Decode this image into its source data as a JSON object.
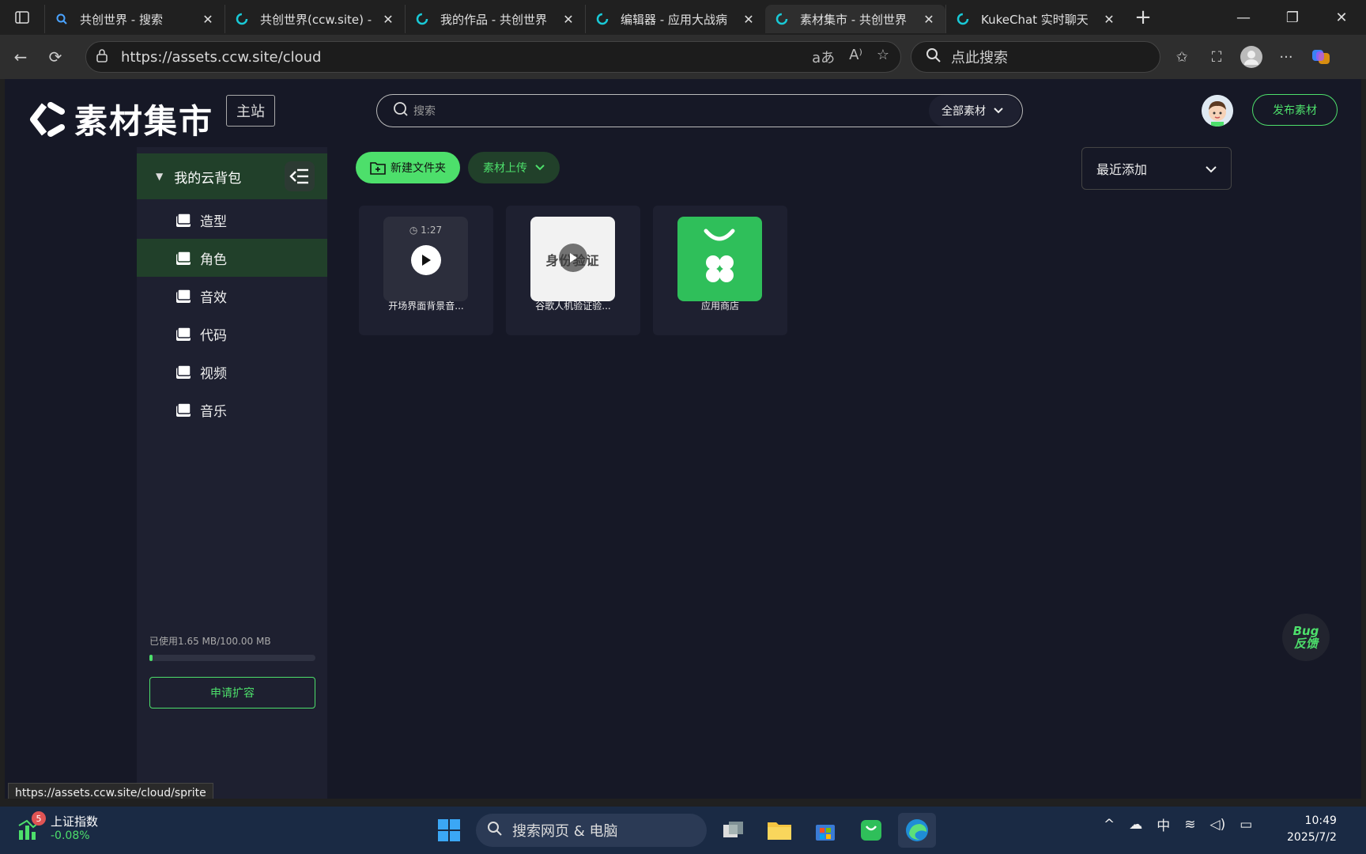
{
  "browser": {
    "tabs": [
      {
        "title": "共创世界 - 搜索",
        "icon": "search-icon",
        "active": false
      },
      {
        "title": "共创世界(ccw.site) -",
        "icon": "ccw-icon",
        "active": false
      },
      {
        "title": "我的作品 - 共创世界",
        "icon": "ccw-icon",
        "active": false
      },
      {
        "title": "编辑器 - 应用大战病",
        "icon": "ccw-icon",
        "active": false
      },
      {
        "title": "素材集市 - 共创世界",
        "icon": "ccw-icon",
        "active": true
      },
      {
        "title": "KukeChat 实时聊天",
        "icon": "ccw-icon",
        "active": false
      }
    ],
    "url": "https://assets.ccw.site/cloud",
    "search_placeholder": "点此搜索",
    "status_url": "https://assets.ccw.site/cloud/sprite"
  },
  "site": {
    "logo_text": "素材集市",
    "main_site_label": "主站",
    "search_placeholder": "搜索",
    "category_label": "全部素材",
    "publish_label": "发布素材"
  },
  "sidebar": {
    "header_label": "我的云背包",
    "items": [
      {
        "label": "造型",
        "active": false
      },
      {
        "label": "角色",
        "active": true
      },
      {
        "label": "音效",
        "active": false
      },
      {
        "label": "代码",
        "active": false
      },
      {
        "label": "视频",
        "active": false
      },
      {
        "label": "音乐",
        "active": false
      }
    ],
    "usage_text": "已使用1.65 MB/100.00 MB",
    "usage_fraction": 0.0165,
    "expand_label": "申请扩容"
  },
  "toolbar": {
    "new_folder_label": "新建文件夹",
    "upload_label": "素材上传",
    "sort_label": "最近添加"
  },
  "assets": [
    {
      "name": "开场界面背景音...",
      "type": "audio",
      "duration": "1:27"
    },
    {
      "name": "谷歌人机验证验...",
      "type": "video",
      "thumb_text": "身份验证"
    },
    {
      "name": "应用商店",
      "type": "app"
    }
  ],
  "bug_button": {
    "line1": "Bug",
    "line2": "反馈"
  },
  "taskbar": {
    "stock_name": "上证指数",
    "stock_change": "-0.08%",
    "stock_badge": "5",
    "search_text": "搜索网页 & 电脑",
    "ime": "中",
    "time": "10:49",
    "date": "2025/7/2"
  },
  "colors": {
    "accent": "#4ddf6b",
    "page_bg": "#161826",
    "panel_bg": "#1e2030",
    "active_bg": "#21402a"
  }
}
